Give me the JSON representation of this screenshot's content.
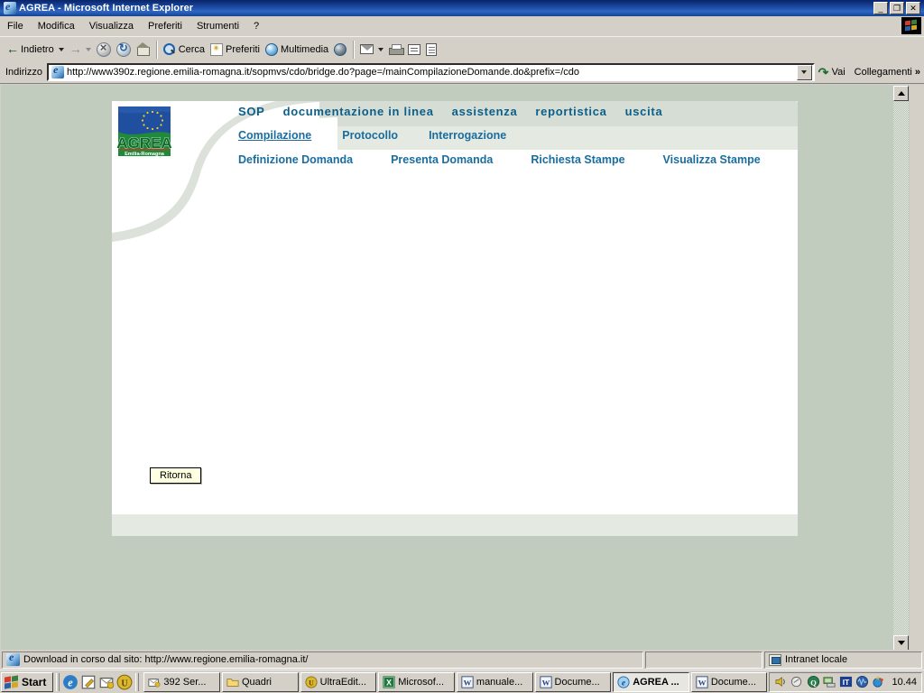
{
  "window": {
    "title": "AGREA - Microsoft Internet Explorer",
    "minimize_label": "_",
    "restore_label": "❐",
    "close_label": "✕"
  },
  "menu": {
    "items": [
      "File",
      "Modifica",
      "Visualizza",
      "Preferiti",
      "Strumenti",
      "?"
    ]
  },
  "toolbar": {
    "back": "Indietro",
    "forward": "",
    "stop": "",
    "refresh": "",
    "home": "",
    "search": "Cerca",
    "favorites": "Preferiti",
    "media": "Multimedia",
    "history": "",
    "mail": "",
    "print": "",
    "edit": "",
    "discuss": ""
  },
  "address": {
    "label": "Indirizzo",
    "url": "http://www390z.regione.emilia-romagna.it/sopmvs/cdo/bridge.do?page=/mainCompilazioneDomande.do&prefix=/cdo",
    "go_label": "Vai",
    "links_label": "Collegamenti",
    "links_chevron": "»"
  },
  "page": {
    "logo": {
      "title": "AGREA",
      "subtitle": "Emilia-Romagna"
    },
    "nav_primary": [
      "SOP",
      "documentazione in linea",
      "assistenza",
      "reportistica",
      "uscita"
    ],
    "nav_secondary": [
      {
        "label": "Compilazione",
        "active": true
      },
      {
        "label": "Protocollo",
        "active": false
      },
      {
        "label": "Interrogazione",
        "active": false
      }
    ],
    "nav_tertiary": [
      "Definizione Domanda",
      "Presenta Domanda",
      "Richiesta Stampe",
      "Visualizza Stampe"
    ],
    "return_button": "Ritorna"
  },
  "statusbar": {
    "message": "Download in corso dal sito: http://www.regione.emilia-romagna.it/",
    "zone": "Intranet locale"
  },
  "taskbar": {
    "start_label": "Start",
    "quick_launch": [
      "ie-icon",
      "edit-icon",
      "mail-icon",
      "ultraedit-icon"
    ],
    "tasks": [
      {
        "label": "392 Ser...",
        "icon": "mail-icon",
        "active": false
      },
      {
        "label": "Quadri",
        "icon": "folder-icon",
        "active": false
      },
      {
        "label": "UltraEdit...",
        "icon": "ultraedit-icon",
        "active": false
      },
      {
        "label": "Microsof...",
        "icon": "excel-icon",
        "active": false
      },
      {
        "label": "manuale...",
        "icon": "word-icon",
        "active": false
      },
      {
        "label": "Docume...",
        "icon": "word-icon",
        "active": false
      },
      {
        "label": "AGREA ...",
        "icon": "ie-icon",
        "active": true
      },
      {
        "label": "Docume...",
        "icon": "word-icon",
        "active": false
      }
    ],
    "tray_icons": [
      "volume-icon",
      "print-icon",
      "quicktime-icon",
      "network-icon",
      "language-icon",
      "monitor-icon",
      "antivirus-icon"
    ],
    "language_badge": "IT",
    "clock": "10.44"
  },
  "colors": {
    "titlebar": "#0a246a",
    "page_background": "#c2ccbe",
    "panel_background": "#ffffff",
    "nav_primary_color": "#0b5f8a",
    "nav_link_color": "#1a6d9e",
    "button_background": "#ffffe1"
  }
}
